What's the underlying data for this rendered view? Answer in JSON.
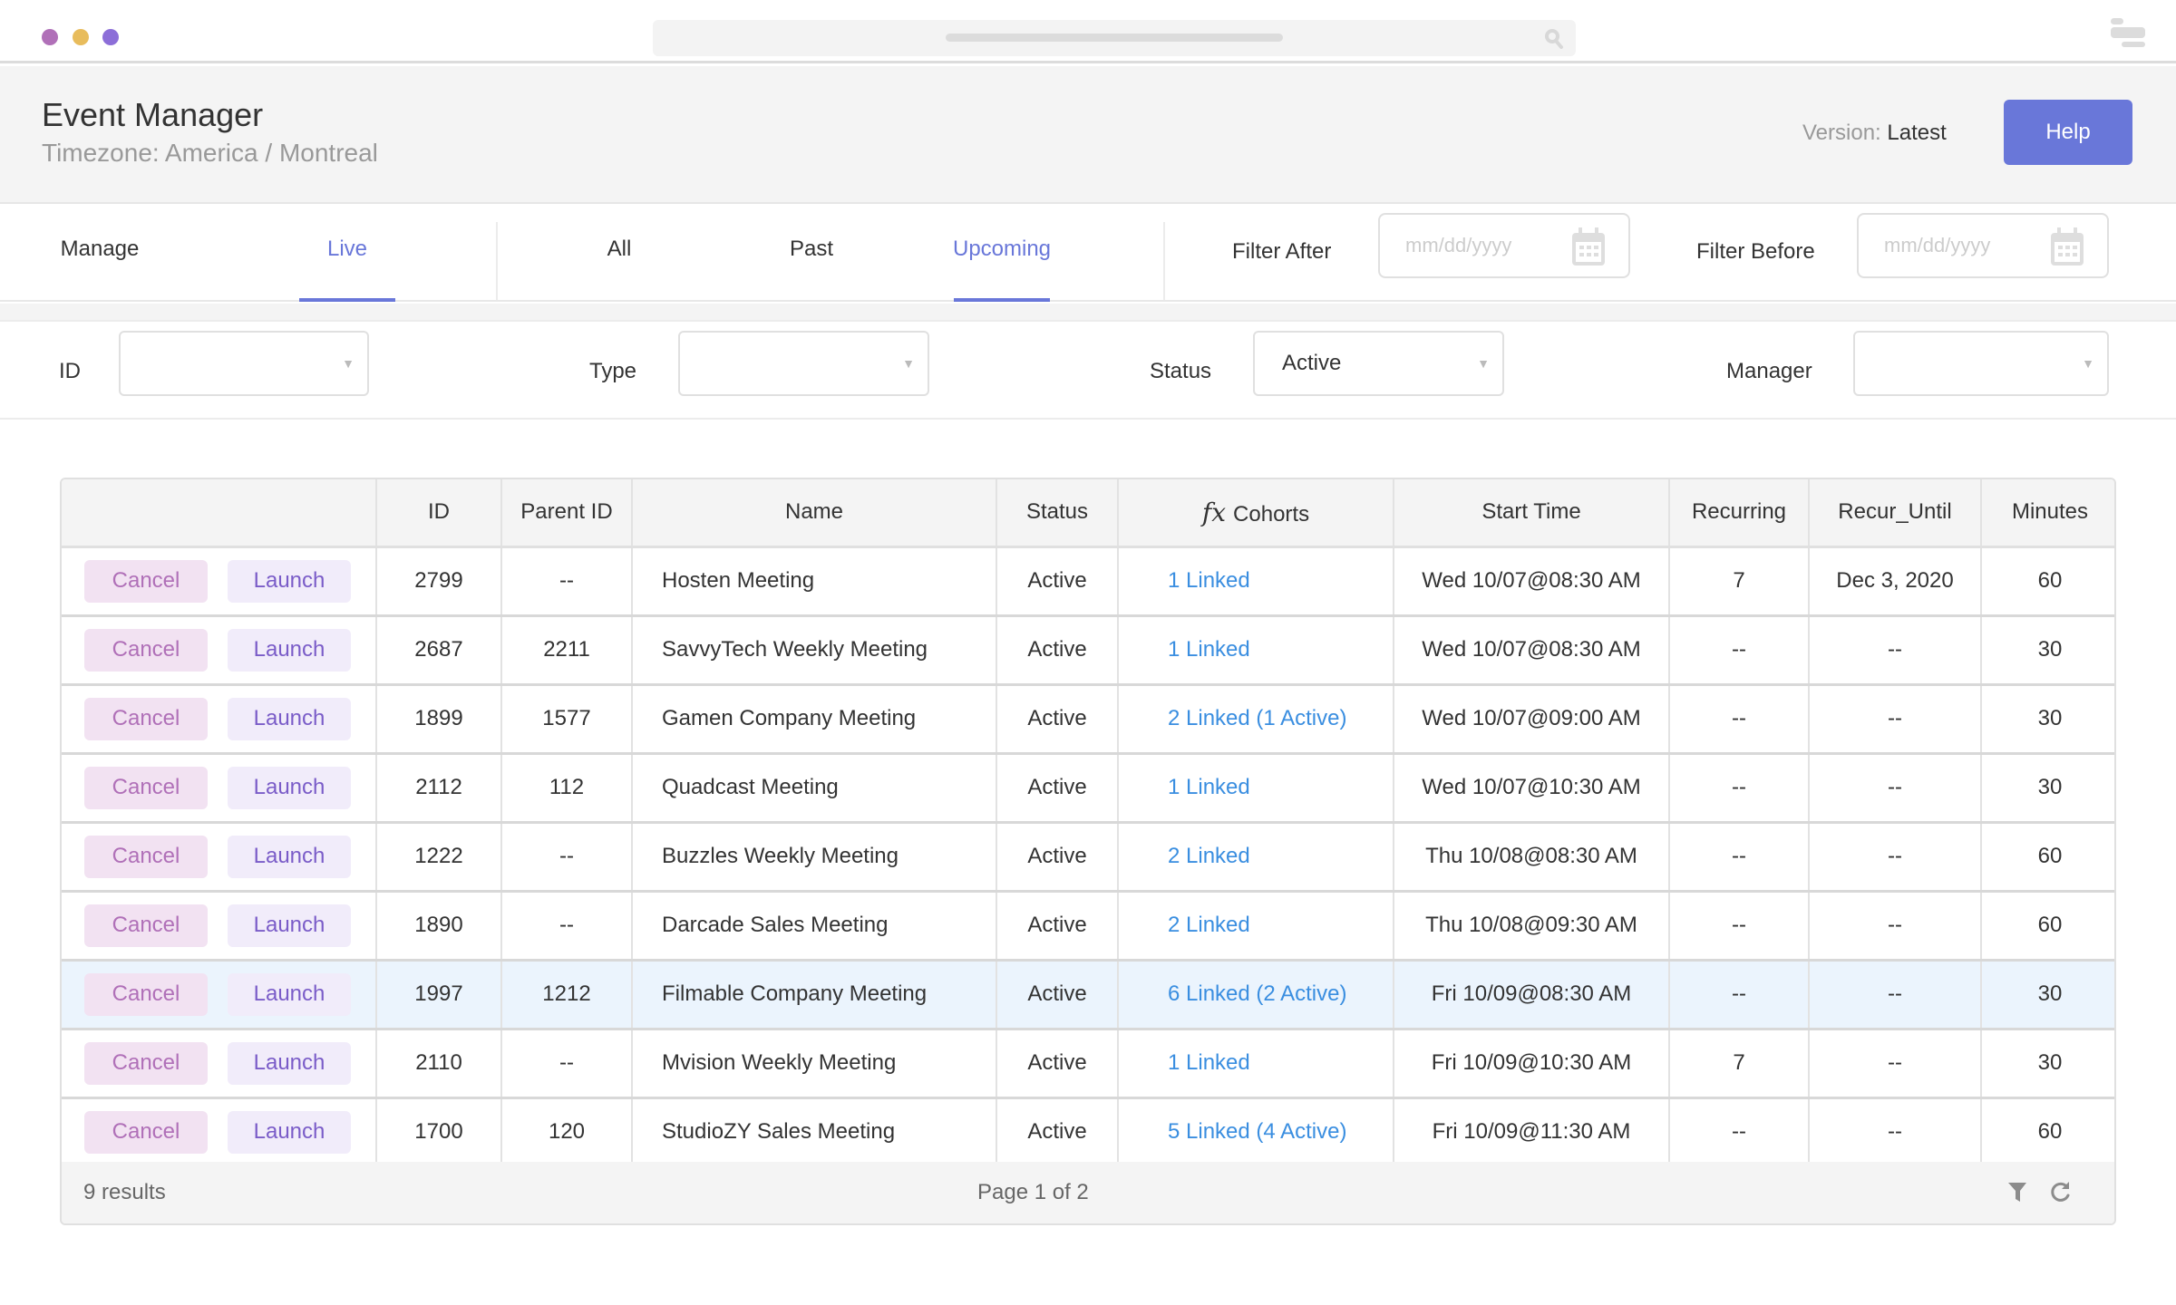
{
  "window": {
    "dots": [
      "#b070b8",
      "#e8bc5c",
      "#8c6ed8"
    ],
    "icons": {
      "search": "search-icon",
      "menu": "menu-icon"
    }
  },
  "header": {
    "title": "Event Manager",
    "subtitle": "Timezone: America / Montreal",
    "version_label": "Version:",
    "version_value": "Latest",
    "help_label": "Help",
    "accent_color": "#6977d9"
  },
  "tabs": {
    "mode": [
      {
        "label": "Manage",
        "active": false
      },
      {
        "label": "Live",
        "active": true
      }
    ],
    "time": [
      {
        "label": "All",
        "active": false
      },
      {
        "label": "Past",
        "active": false
      },
      {
        "label": "Upcoming",
        "active": true
      }
    ],
    "filter_after_label": "Filter After",
    "filter_after_placeholder": "mm/dd/yyyy",
    "filter_before_label": "Filter Before",
    "filter_before_placeholder": "mm/dd/yyyy"
  },
  "filters": {
    "id": {
      "label": "ID",
      "value": ""
    },
    "type": {
      "label": "Type",
      "value": ""
    },
    "status": {
      "label": "Status",
      "value": "Active"
    },
    "manager": {
      "label": "Manager",
      "value": ""
    }
  },
  "table": {
    "columns": [
      "",
      "ID",
      "Parent ID",
      "Name",
      "Status",
      "Cohorts",
      "Start Time",
      "Recurring",
      "Recur_Until",
      "Minutes"
    ],
    "cohorts_prefix": "fx",
    "cancel_label": "Cancel",
    "launch_label": "Launch",
    "rows": [
      {
        "id": "2799",
        "parent_id": "--",
        "name": "Hosten Meeting",
        "status": "Active",
        "cohorts": "1 Linked",
        "start": "Wed 10/07@08:30 AM",
        "recurring": "7",
        "recur_until": "Dec 3, 2020",
        "minutes": "60",
        "highlighted": false
      },
      {
        "id": "2687",
        "parent_id": "2211",
        "name": "SavvyTech Weekly Meeting",
        "status": "Active",
        "cohorts": "1 Linked",
        "start": "Wed 10/07@08:30 AM",
        "recurring": "--",
        "recur_until": "--",
        "minutes": "30",
        "highlighted": false
      },
      {
        "id": "1899",
        "parent_id": "1577",
        "name": "Gamen Company Meeting",
        "status": "Active",
        "cohorts": "2 Linked (1 Active)",
        "start": "Wed 10/07@09:00 AM",
        "recurring": "--",
        "recur_until": "--",
        "minutes": "30",
        "highlighted": false
      },
      {
        "id": "2112",
        "parent_id": "112",
        "name": "Quadcast Meeting",
        "status": "Active",
        "cohorts": "1 Linked",
        "start": "Wed 10/07@10:30 AM",
        "recurring": "--",
        "recur_until": "--",
        "minutes": "30",
        "highlighted": false
      },
      {
        "id": "1222",
        "parent_id": "--",
        "name": "Buzzles Weekly Meeting",
        "status": "Active",
        "cohorts": "2 Linked",
        "start": "Thu 10/08@08:30 AM",
        "recurring": "--",
        "recur_until": "--",
        "minutes": "60",
        "highlighted": false
      },
      {
        "id": "1890",
        "parent_id": "--",
        "name": "Darcade Sales Meeting",
        "status": "Active",
        "cohorts": "2 Linked",
        "start": "Thu 10/08@09:30 AM",
        "recurring": "--",
        "recur_until": "--",
        "minutes": "60",
        "highlighted": false
      },
      {
        "id": "1997",
        "parent_id": "1212",
        "name": "Filmable Company Meeting",
        "status": "Active",
        "cohorts": "6 Linked (2 Active)",
        "start": "Fri 10/09@08:30 AM",
        "recurring": "--",
        "recur_until": "--",
        "minutes": "30",
        "highlighted": true
      },
      {
        "id": "2110",
        "parent_id": "--",
        "name": "Mvision Weekly Meeting",
        "status": "Active",
        "cohorts": "1 Linked",
        "start": "Fri 10/09@10:30 AM",
        "recurring": "7",
        "recur_until": "--",
        "minutes": "30",
        "highlighted": false
      },
      {
        "id": "1700",
        "parent_id": "120",
        "name": "StudioZY Sales  Meeting",
        "status": "Active",
        "cohorts": "5 Linked (4 Active)",
        "start": "Fri 10/09@11:30 AM",
        "recurring": "--",
        "recur_until": "--",
        "minutes": "60",
        "highlighted": false
      }
    ],
    "footer": {
      "results": "9 results",
      "page": "Page 1 of 2"
    }
  }
}
